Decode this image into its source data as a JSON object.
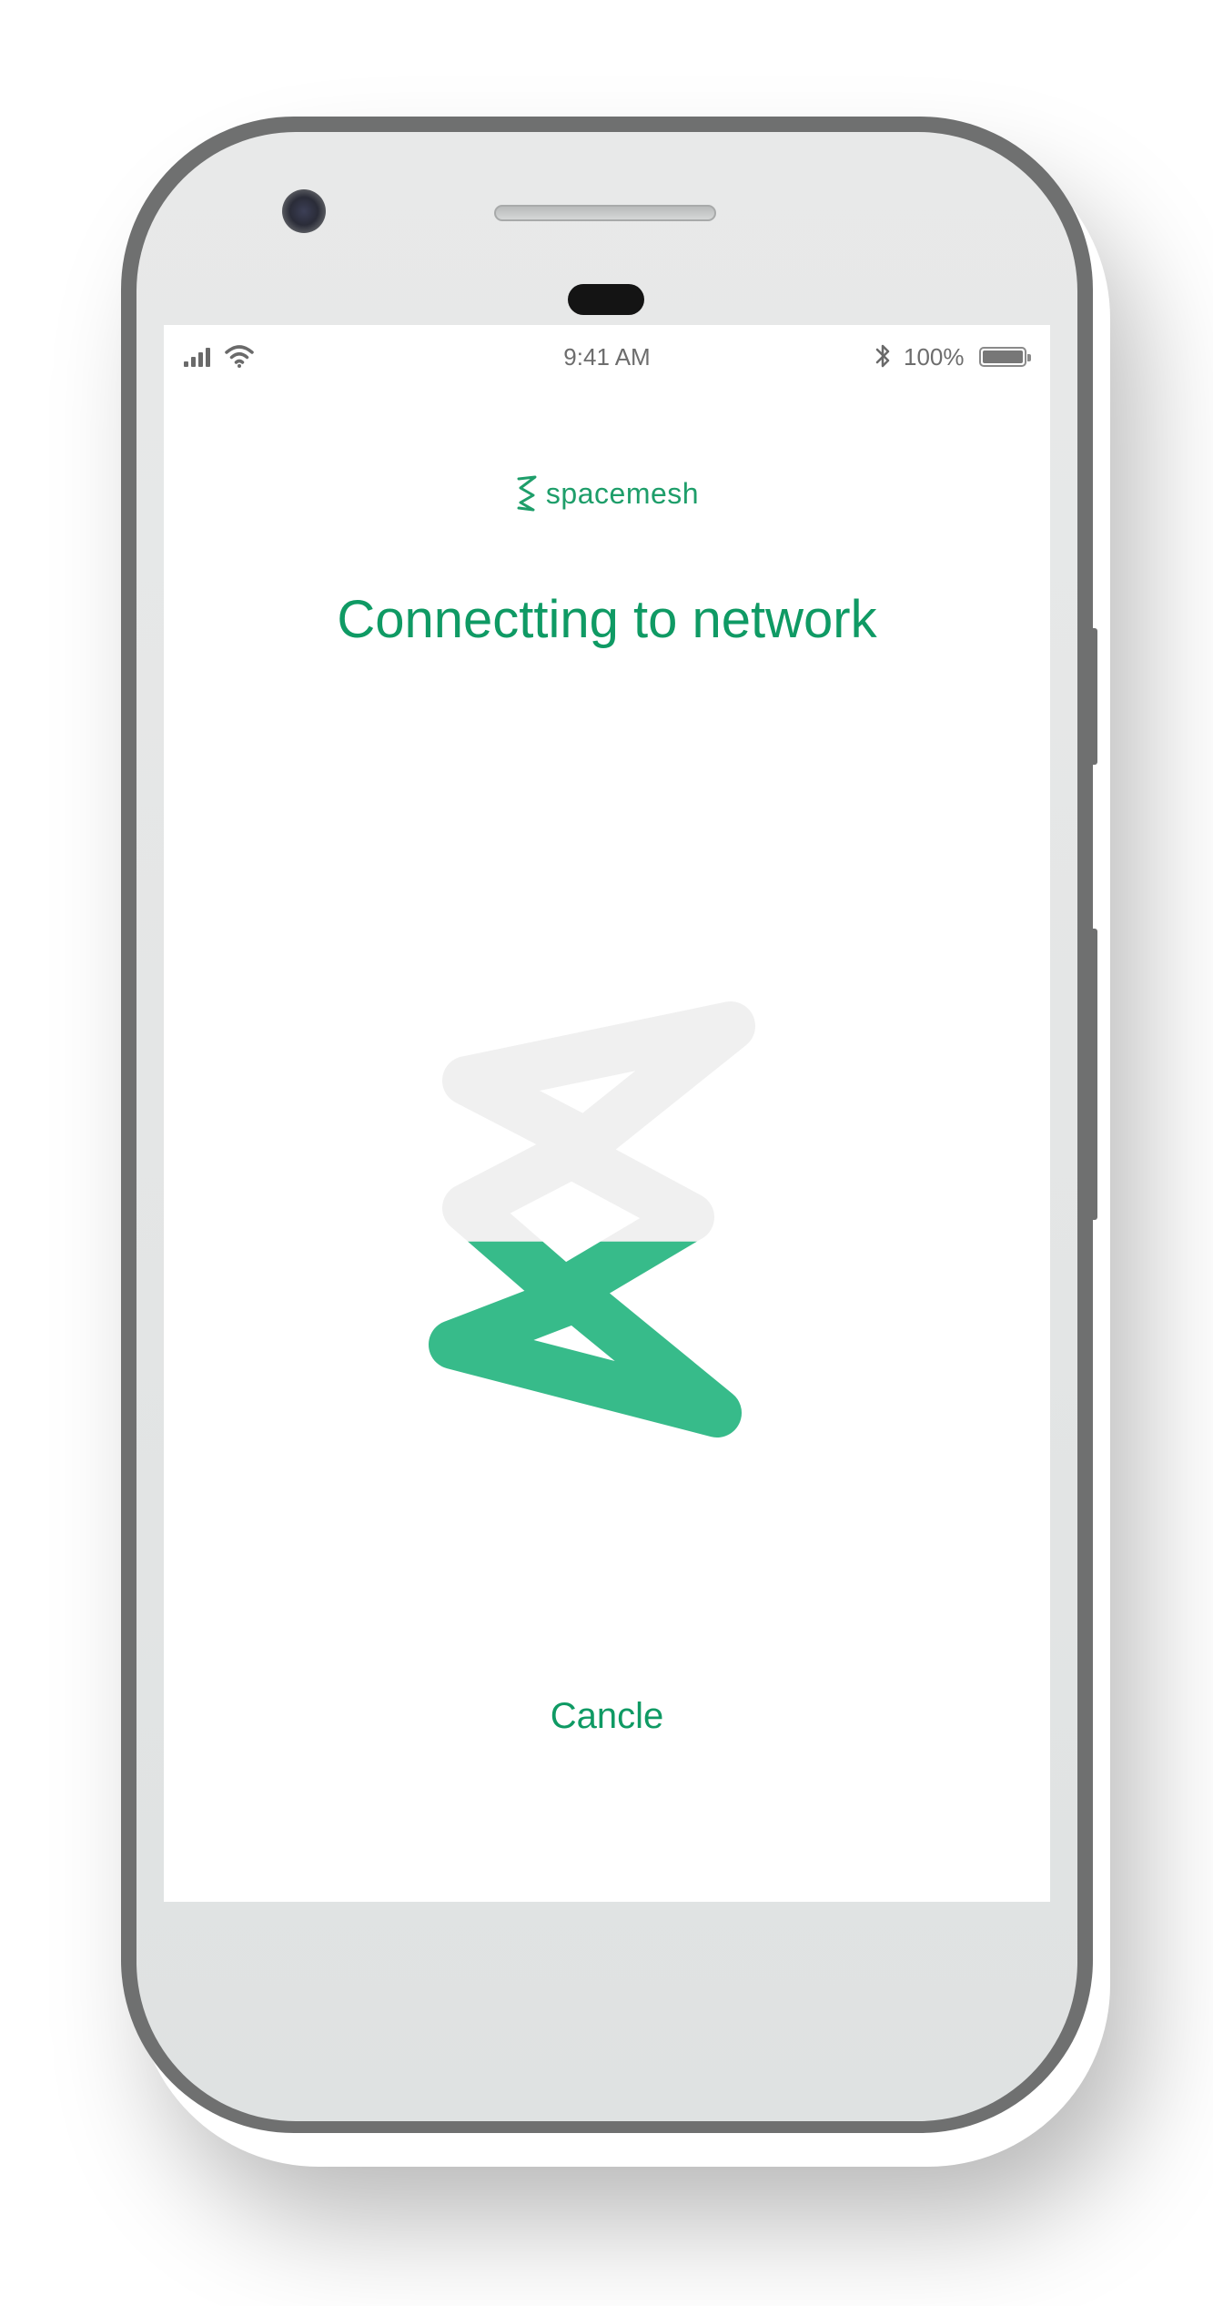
{
  "status_bar": {
    "time": "9:41 AM",
    "battery_percent": "100%",
    "signal_icon": "cellular-signal-icon",
    "wifi_icon": "wifi-icon",
    "bluetooth_icon": "bluetooth-icon",
    "battery_icon": "battery-icon",
    "battery_level": 1.0
  },
  "brand": {
    "logo_icon": "spacemesh-logo-icon",
    "name": "spacemesh"
  },
  "main": {
    "title": "Connectting to network",
    "loader_icon": "spacemesh-hourglass-loader-icon",
    "loader_progress": 0.45,
    "cancel_label": "Cancle"
  },
  "colors": {
    "accent": "#0f9a64",
    "loader_fill": "#37bb8a",
    "loader_empty": "#f0f0f0",
    "status_text": "#6d6d6d"
  }
}
